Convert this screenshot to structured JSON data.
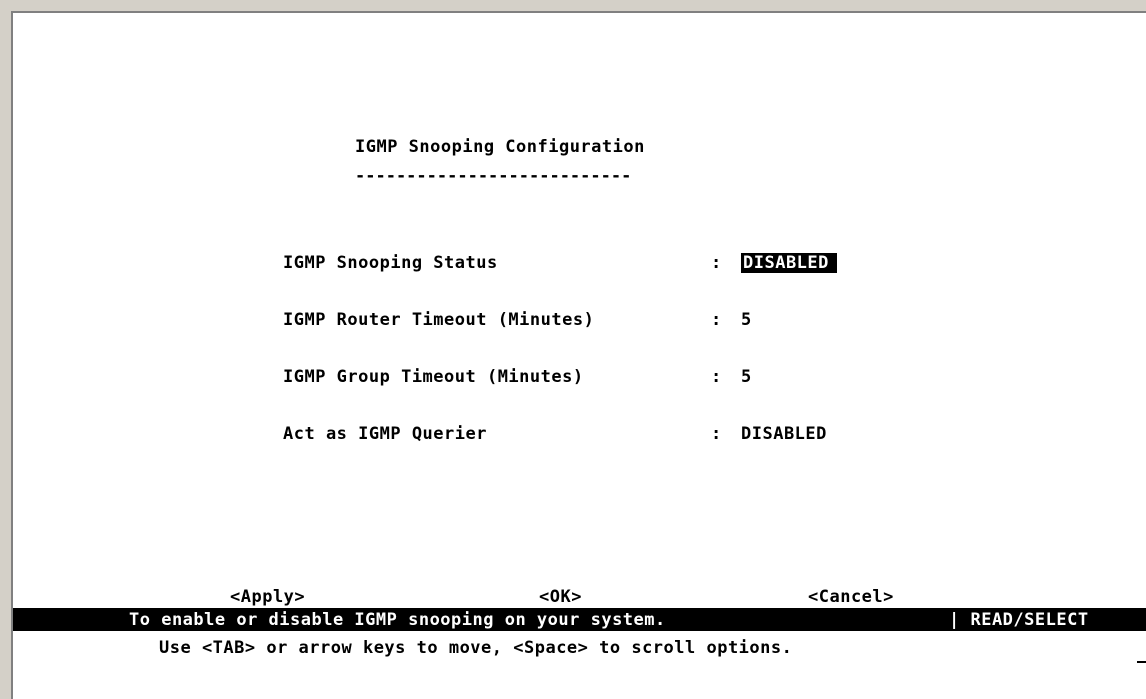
{
  "screen": {
    "title": "IGMP Snooping Configuration",
    "title_underline": "---------------------------"
  },
  "fields": [
    {
      "label": "IGMP Snooping Status",
      "separator": ":",
      "value": "DISABLED"
    },
    {
      "label": "IGMP Router Timeout (Minutes)",
      "separator": ":",
      "value": "5"
    },
    {
      "label": "IGMP Group Timeout (Minutes)",
      "separator": ":",
      "value": "5"
    },
    {
      "label": "Act as IGMP Querier",
      "separator": ":",
      "value": "DISABLED"
    }
  ],
  "actions": {
    "apply_label": "<Apply>",
    "ok_label": "<OK>",
    "cancel_label": "<Cancel>"
  },
  "status_bar": {
    "message": "To enable or disable IGMP snooping on your system.",
    "mode": "| READ/SELECT"
  },
  "hint": "Use <TAB> or arrow keys to move, <Space> to scroll options.",
  "colors": {
    "frame": "#d4d0c8",
    "frame_shadow": "#808080",
    "terminal_bg": "#ffffff",
    "text": "#000000",
    "highlight_bg": "#000000",
    "highlight_text": "#ffffff"
  }
}
